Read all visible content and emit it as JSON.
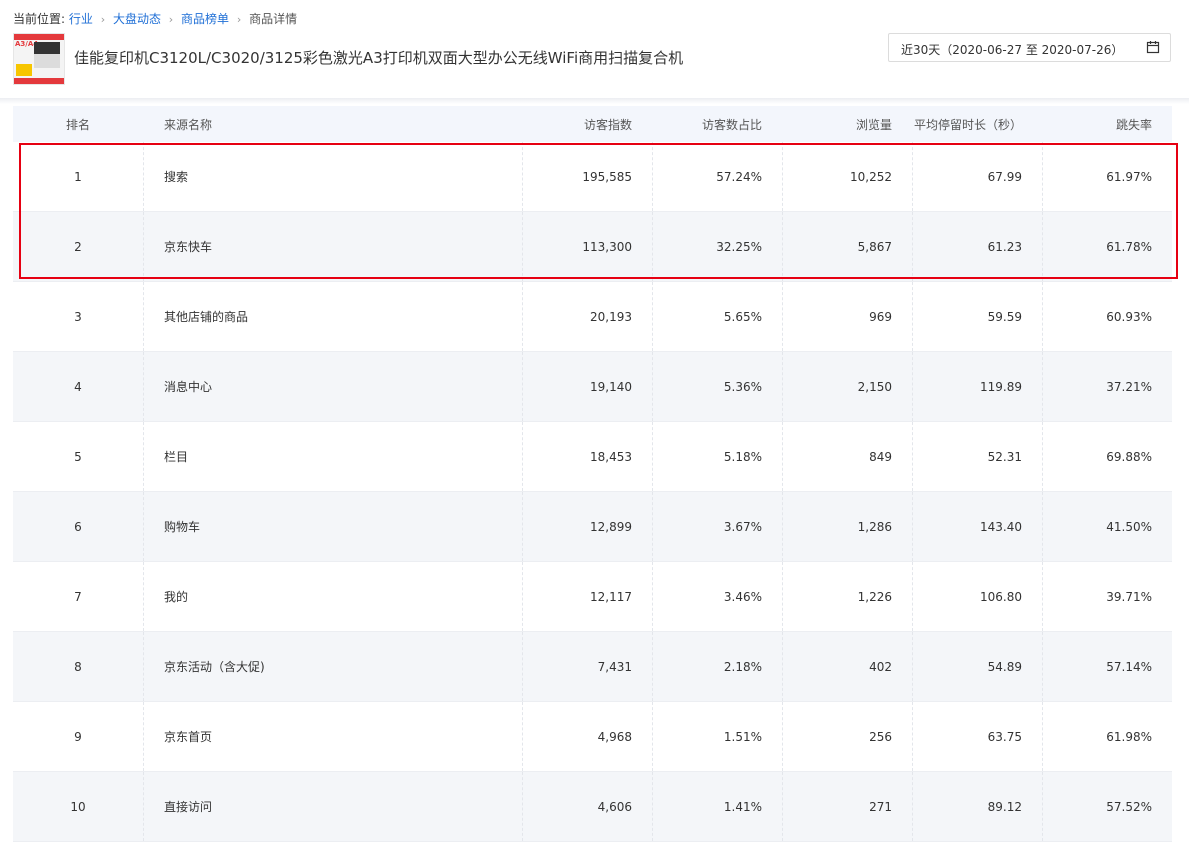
{
  "breadcrumb": {
    "label": "当前位置:",
    "items": [
      "行业",
      "大盘动态",
      "商品榜单"
    ],
    "current": "商品详情"
  },
  "product": {
    "title": "佳能复印机C3120L/C3020/3125彩色激光A3打印机双面大型办公无线WiFi商用扫描复合机",
    "thumb_text": "A3/A4"
  },
  "date_picker": {
    "value": "近30天（2020-06-27 至 2020-07-26）",
    "icon": "calendar-icon"
  },
  "table": {
    "headers": [
      "排名",
      "来源名称",
      "访客指数",
      "访客数占比",
      "浏览量",
      "平均停留时长（秒）",
      "跳失率"
    ],
    "rows": [
      {
        "rank": "1",
        "source": "搜索",
        "visitors": "195,585",
        "share": "57.24%",
        "pv": "10,252",
        "avg": "67.99",
        "bounce": "61.97%"
      },
      {
        "rank": "2",
        "source": "京东快车",
        "visitors": "113,300",
        "share": "32.25%",
        "pv": "5,867",
        "avg": "61.23",
        "bounce": "61.78%"
      },
      {
        "rank": "3",
        "source": "其他店铺的商品",
        "visitors": "20,193",
        "share": "5.65%",
        "pv": "969",
        "avg": "59.59",
        "bounce": "60.93%"
      },
      {
        "rank": "4",
        "source": "消息中心",
        "visitors": "19,140",
        "share": "5.36%",
        "pv": "2,150",
        "avg": "119.89",
        "bounce": "37.21%"
      },
      {
        "rank": "5",
        "source": "栏目",
        "visitors": "18,453",
        "share": "5.18%",
        "pv": "849",
        "avg": "52.31",
        "bounce": "69.88%"
      },
      {
        "rank": "6",
        "source": "购物车",
        "visitors": "12,899",
        "share": "3.67%",
        "pv": "1,286",
        "avg": "143.40",
        "bounce": "41.50%"
      },
      {
        "rank": "7",
        "source": "我的",
        "visitors": "12,117",
        "share": "3.46%",
        "pv": "1,226",
        "avg": "106.80",
        "bounce": "39.71%"
      },
      {
        "rank": "8",
        "source": "京东活动（含大促)",
        "visitors": "7,431",
        "share": "2.18%",
        "pv": "402",
        "avg": "54.89",
        "bounce": "57.14%"
      },
      {
        "rank": "9",
        "source": "京东首页",
        "visitors": "4,968",
        "share": "1.51%",
        "pv": "256",
        "avg": "63.75",
        "bounce": "61.98%"
      },
      {
        "rank": "10",
        "source": "直接访问",
        "visitors": "4,606",
        "share": "1.41%",
        "pv": "271",
        "avg": "89.12",
        "bounce": "57.52%"
      }
    ]
  },
  "colors": {
    "link": "#1f6fd6",
    "highlight_border": "#e60012",
    "header_bg": "#f3f6fc",
    "stripe_bg": "#f4f6f9"
  }
}
